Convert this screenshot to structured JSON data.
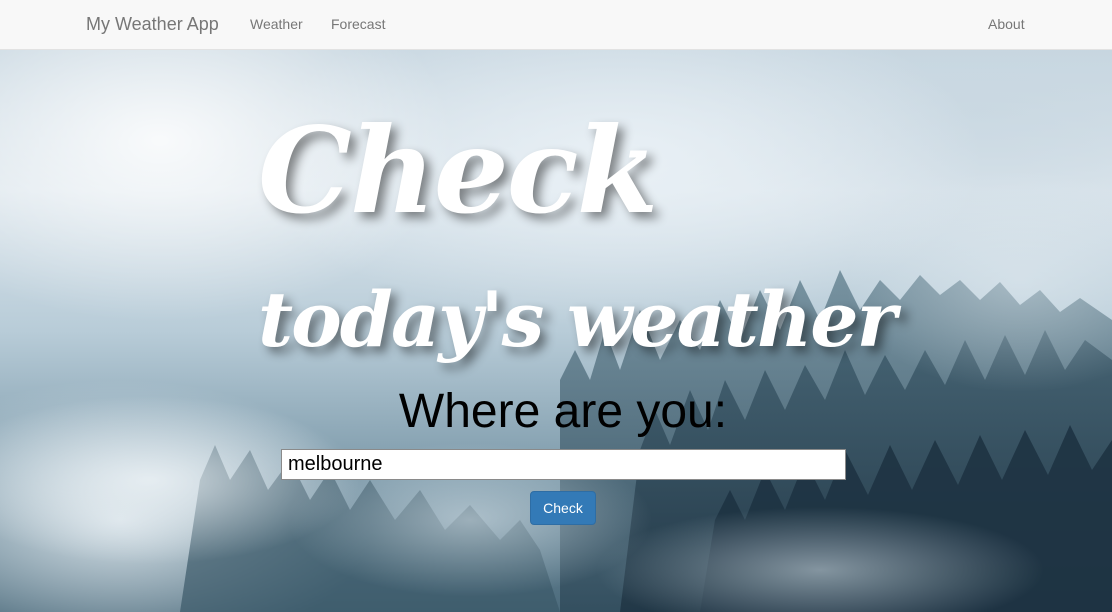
{
  "navbar": {
    "brand": "My Weather App",
    "links": [
      "Weather",
      "Forecast"
    ],
    "right_link": "About"
  },
  "hero": {
    "headline_line1": "Check",
    "headline_line2": "today's weather",
    "prompt": "Where are you:",
    "location_value": "melbourne",
    "submit_label": "Check"
  },
  "colors": {
    "navbar_bg": "#f8f8f8",
    "nav_text": "#777777",
    "button_primary": "#337ab7",
    "headline_text": "#ffffff"
  }
}
